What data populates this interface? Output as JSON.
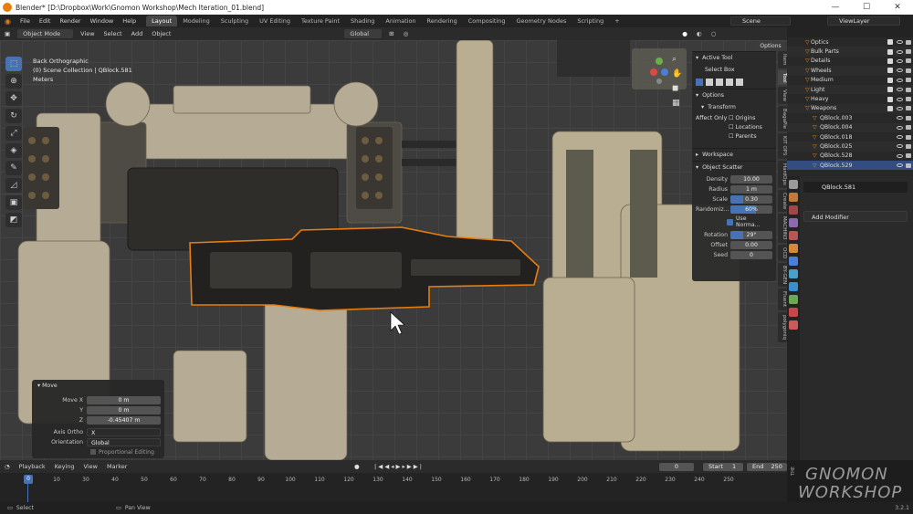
{
  "window": {
    "title": "Blender* [D:\\Dropbox\\Work\\Gnomon Workshop\\Mech Iteration_01.blend]",
    "controls": [
      "—",
      "☐",
      "✕"
    ]
  },
  "menu": [
    "File",
    "Edit",
    "Render",
    "Window",
    "Help"
  ],
  "workspaces": [
    "Layout",
    "Modeling",
    "Sculpting",
    "UV Editing",
    "Texture Paint",
    "Shading",
    "Animation",
    "Rendering",
    "Compositing",
    "Geometry Nodes",
    "Scripting",
    "+"
  ],
  "active_workspace": "Layout",
  "scene": "Scene",
  "view_layer": "ViewLayer",
  "viewport_header": {
    "mode": "Object Mode",
    "menus": [
      "View",
      "Select",
      "Add",
      "Object"
    ],
    "orientation": "Global",
    "options": "Options"
  },
  "viewport_info": {
    "view": "Back Orthographic",
    "collection": "(0) Scene Collection | QBlock.581",
    "units": "Meters"
  },
  "npanel": {
    "active_tool": "Active Tool",
    "tool_name": "Select Box",
    "options": "Options",
    "transform": "Transform",
    "affect_only": "Affect Only",
    "affect_items": [
      "Origins",
      "Locations",
      "Parents"
    ],
    "workspace": "Workspace",
    "object_scatter": "Object Scatter",
    "fields": [
      {
        "label": "Density",
        "value": "10.00",
        "fill": 0
      },
      {
        "label": "Radius",
        "value": "1 m",
        "fill": 0
      },
      {
        "label": "Scale",
        "value": "0.30",
        "fill": 0.3
      },
      {
        "label": "Randomiz...",
        "value": "60%",
        "fill": 0.6
      }
    ],
    "use_normal": "Use Norma...",
    "fields2": [
      {
        "label": "Rotation",
        "value": "29°",
        "fill": 0.3
      },
      {
        "label": "Offset",
        "value": "0.00",
        "fill": 0
      },
      {
        "label": "Seed",
        "value": "0",
        "fill": 0
      }
    ],
    "side_tabs": [
      "Item",
      "Tool",
      "View",
      "BagaPie",
      "KIT OPS",
      "HardOps",
      "Create",
      "MACHIN3",
      "OCD",
      "BY-GEN",
      "Fluent",
      "polygoniq"
    ]
  },
  "move_panel": {
    "title": "Move",
    "rows": [
      {
        "label": "Move X",
        "value": "0 m"
      },
      {
        "label": "Y",
        "value": "0 m"
      },
      {
        "label": "Z",
        "value": "-0.45407 m"
      }
    ],
    "axis_ortho_label": "Axis Ortho",
    "axis_ortho": "X",
    "orientation_label": "Orientation",
    "orientation": "Global",
    "proportional": "Proportional Editing"
  },
  "outliner": {
    "items": [
      "Optics",
      "Bulk Parts",
      "Details",
      "Wheels",
      "Medium",
      "Light",
      "Heavy",
      "Weapons",
      "QBlock.003",
      "QBlock.004",
      "QBlock.018",
      "QBlock.025",
      "QBlock.528",
      "QBlock.529"
    ],
    "selected": "QBlock.529"
  },
  "properties": {
    "object": "QBlock.581",
    "add_modifier": "Add Modifier"
  },
  "timeline": {
    "menus": [
      "Playback",
      "Keying",
      "View",
      "Marker"
    ],
    "current_frame": "0",
    "start_label": "Start",
    "start": "1",
    "end_label": "End",
    "end": "250",
    "ticks": [
      "0",
      "10",
      "30",
      "40",
      "50",
      "60",
      "70",
      "80",
      "90",
      "100",
      "110",
      "120",
      "130",
      "140",
      "150",
      "160",
      "170",
      "180",
      "190",
      "200",
      "210",
      "220",
      "230",
      "240",
      "250"
    ]
  },
  "status": {
    "select": "Select",
    "pan": "Pan View",
    "version": "3.2.1"
  },
  "watermark": {
    "the": "THE",
    "top": "GNOMON",
    "bottom": "WORKSHOP"
  },
  "colors": {
    "accent": "#4772b3",
    "selection": "#e87d0d",
    "bg": "#3b3b3b"
  }
}
